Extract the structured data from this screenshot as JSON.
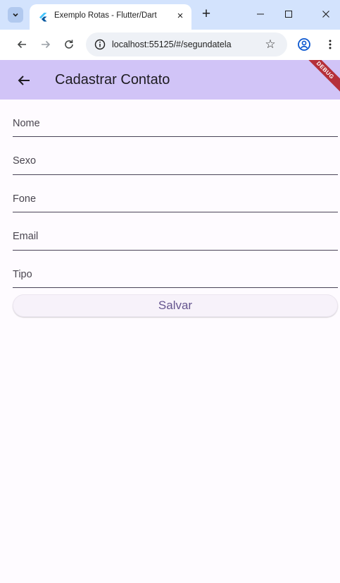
{
  "browser": {
    "tab_title": "Exemplo Rotas - Flutter/Dart",
    "url": "localhost:55125/#/segundatela",
    "icons": {
      "tab_search": "chevron-down-icon",
      "tab_close": "close-icon",
      "new_tab": "plus-icon",
      "back": "arrow-left-icon",
      "forward": "arrow-right-icon",
      "reload": "reload-icon",
      "site_info": "info-icon",
      "bookmark": "star-icon",
      "profile": "profile-icon",
      "menu": "more-vert-icon"
    }
  },
  "app": {
    "title": "Cadastrar Contato",
    "debug_banner": "DEBUG",
    "fields": [
      {
        "label": "Nome"
      },
      {
        "label": "Sexo"
      },
      {
        "label": "Fone"
      },
      {
        "label": "Email"
      },
      {
        "label": "Tipo"
      }
    ],
    "save_label": "Salvar"
  },
  "colors": {
    "appbar": "#d1c4f7",
    "background": "#fefbff",
    "button_text": "#65558f",
    "debug_banner": "#b5303a",
    "tabbar": "#d3e3fd"
  }
}
